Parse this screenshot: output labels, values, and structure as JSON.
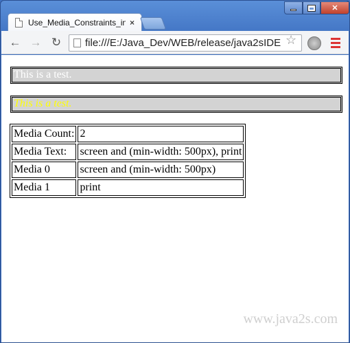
{
  "browser": {
    "tab_title": "Use_Media_Constraints_in",
    "tab_close": "×",
    "url": "file:///E:/Java_Dev/WEB/release/java2sIDE"
  },
  "page": {
    "line1": "This is a test.",
    "line2": "This is a test.",
    "table": [
      [
        "Media Count:",
        "2"
      ],
      [
        "Media Text:",
        "screen and (min-width: 500px), print"
      ],
      [
        "Media 0",
        "screen and (min-width: 500px)"
      ],
      [
        "Media 1",
        "print"
      ]
    ],
    "watermark": "www.java2s.com"
  },
  "colors": {
    "line1_text": "#ffffff",
    "line2_text": "#ffff00",
    "box_bg": "#d3d3d3"
  }
}
